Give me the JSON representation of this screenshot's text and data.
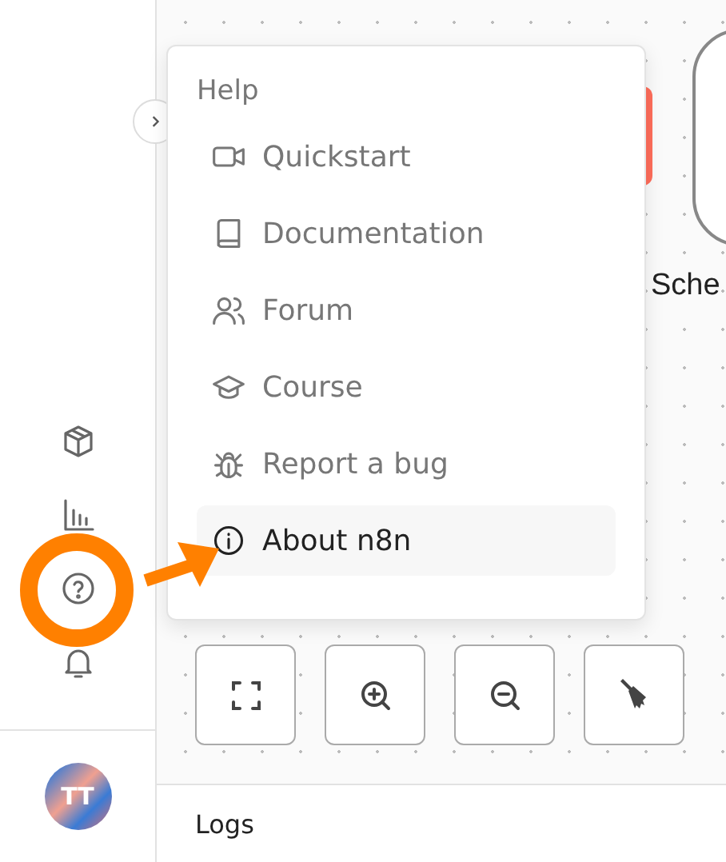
{
  "help_menu": {
    "title": "Help",
    "items": [
      {
        "label": "Quickstart",
        "kind": "video",
        "selected": false
      },
      {
        "label": "Documentation",
        "kind": "book",
        "selected": false
      },
      {
        "label": "Forum",
        "kind": "people",
        "selected": false
      },
      {
        "label": "Course",
        "kind": "cap",
        "selected": false
      },
      {
        "label": "Report a bug",
        "kind": "bug",
        "selected": false
      },
      {
        "label": "About n8n",
        "kind": "info",
        "selected": true
      }
    ]
  },
  "canvas": {
    "node_label": "Sche"
  },
  "user": {
    "initials": "TT"
  },
  "logs": {
    "title": "Logs"
  }
}
